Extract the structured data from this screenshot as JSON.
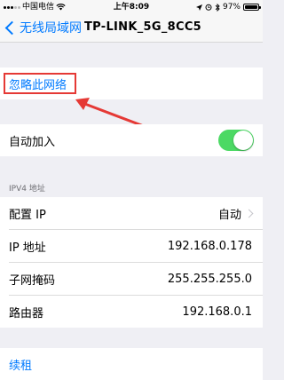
{
  "status_bar": {
    "carrier": "中国电信",
    "time": "上午8:09",
    "battery": "97%",
    "battery_level": 0.97
  },
  "nav": {
    "back_label": "无线局域网",
    "title": "TP-LINK_5G_8CC5"
  },
  "forget": {
    "label": "忽略此网络"
  },
  "auto_join": {
    "label": "自动加入",
    "enabled": true
  },
  "ipv4": {
    "header": "IPV4 地址",
    "rows": [
      {
        "label": "配置 IP",
        "value": "自动"
      },
      {
        "label": "IP 地址",
        "value": "192.168.0.178"
      },
      {
        "label": "子网掩码",
        "value": "255.255.255.0"
      },
      {
        "label": "路由器",
        "value": "192.168.0.1"
      }
    ]
  },
  "renew": {
    "label": "续租"
  },
  "colors": {
    "accent": "#007aff",
    "toggle_on": "#4cd964",
    "annotation": "#e53935"
  }
}
